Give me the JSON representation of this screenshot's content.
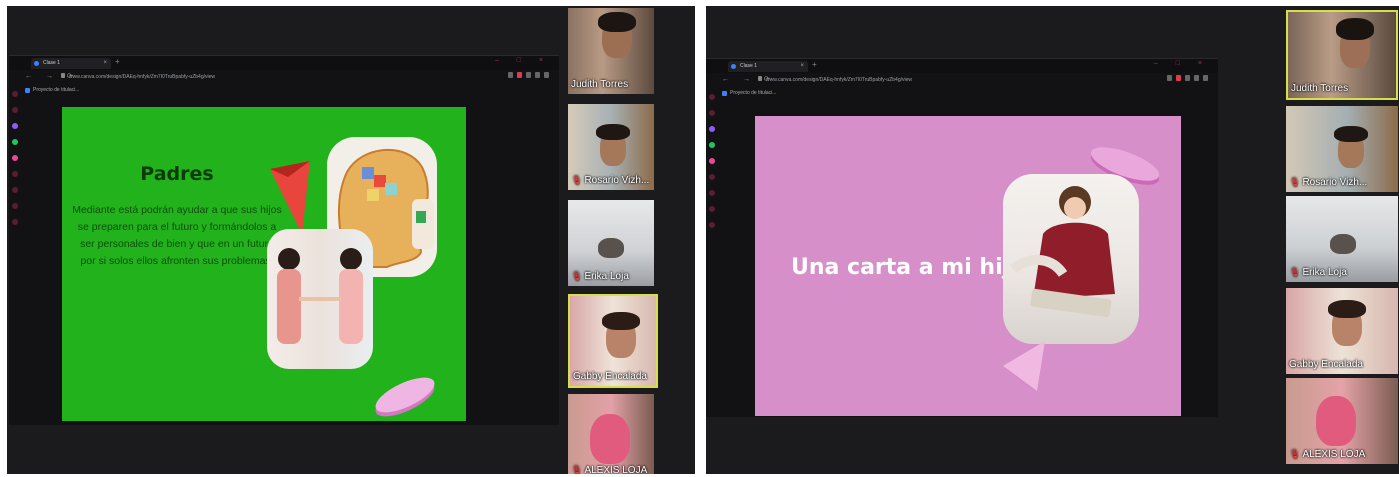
{
  "left": {
    "browser": {
      "tab_title": "Clase 1",
      "url": "www.canva.com/design/DAEq-hnfyk/Zm7I0TruBpabfy-uZb4g/view",
      "bookmark": "Proyecto de titulaci..."
    },
    "slide": {
      "background": "#21b21c",
      "title": "Padres",
      "body": "Mediante está podrán ayudar a que sus hijos se preparen para el futuro y formándolos a ser personales de bien y que en un futuro por si solos ellos afronten sus problemas."
    },
    "participants": [
      {
        "name": "Judith Torres",
        "muted": false,
        "active": false
      },
      {
        "name": "Rosario Vizh...",
        "muted": true,
        "active": false
      },
      {
        "name": "Erika Loja",
        "muted": true,
        "active": false
      },
      {
        "name": "Gabby Encalada",
        "muted": false,
        "active": true
      },
      {
        "name": "ALEXIS LOJA",
        "muted": true,
        "active": false
      }
    ]
  },
  "right": {
    "browser": {
      "tab_title": "Clase 1",
      "url": "www.canva.com/design/DAEq-hnfyk/Zm7I0TruBpabfy-uZb4g/view",
      "bookmark": "Proyecto de titulaci..."
    },
    "slide": {
      "background": "#d78fca",
      "title": "Una carta a mi hijo"
    },
    "participants": [
      {
        "name": "Judith Torres",
        "muted": false,
        "active": true
      },
      {
        "name": "Rosario Vizh...",
        "muted": true,
        "active": false
      },
      {
        "name": "Erika Loja",
        "muted": true,
        "active": false
      },
      {
        "name": "Gabby Encalada",
        "muted": false,
        "active": false
      },
      {
        "name": "ALEXIS LOJA",
        "muted": true,
        "active": false
      }
    ]
  },
  "icons": {
    "mic_muted": "🎙",
    "close": "×",
    "new_tab": "+",
    "window_controls": "– □ ×",
    "nav": "← → ⟳"
  }
}
